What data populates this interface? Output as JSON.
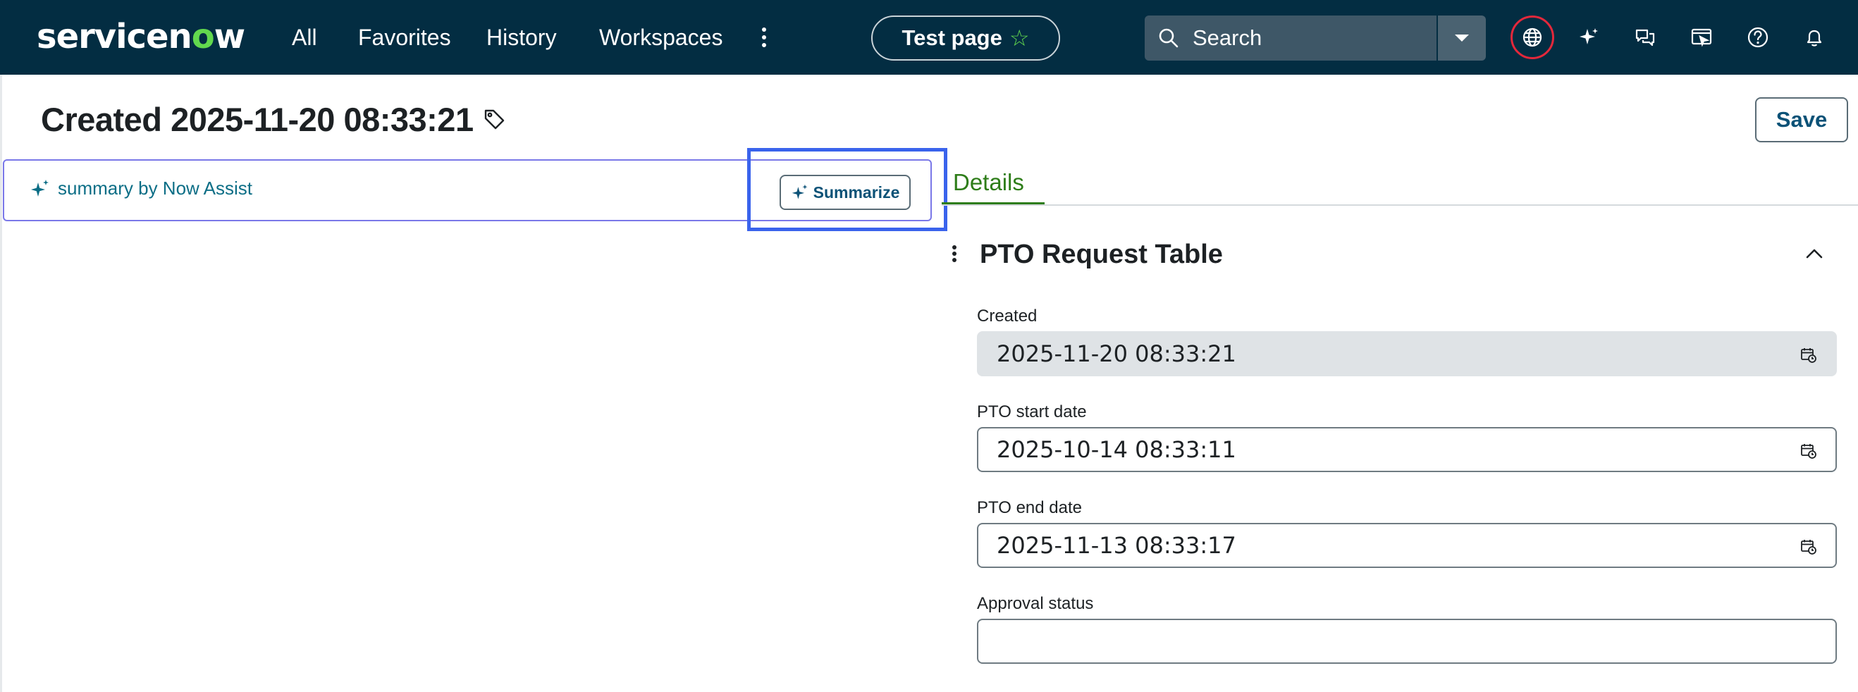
{
  "app": {
    "logo_prefix": "servicen",
    "logo_o": "o",
    "logo_suffix": "w"
  },
  "nav": {
    "items": [
      "All",
      "Favorites",
      "History",
      "Workspaces"
    ],
    "current_page": "Test page",
    "search_placeholder": "Search",
    "icons": [
      "globe-icon",
      "sparkle-icon",
      "chat-icon",
      "screen-icon",
      "help-icon",
      "bell-icon"
    ]
  },
  "header": {
    "title": "Created 2025-11-20 08:33:21",
    "save_label": "Save"
  },
  "summary": {
    "label": "summary by Now Assist",
    "button": "Summarize"
  },
  "tabs": {
    "active": "Details"
  },
  "form": {
    "section_title": "PTO Request Table",
    "fields": [
      {
        "label": "Created",
        "value": "2025-11-20 08:33:21",
        "readonly": true
      },
      {
        "label": "PTO start date",
        "value": "2025-10-14 08:33:11"
      },
      {
        "label": "PTO end date",
        "value": "2025-11-13 08:33:17"
      },
      {
        "label": "Approval status",
        "value": ""
      }
    ]
  },
  "colors": {
    "nav_bg": "#032d42",
    "brand_green": "#62d84e",
    "link_teal": "#0c6e86",
    "tab_green": "#2e7d19",
    "highlight_blue": "#3a63ec",
    "globe_ring_red": "#e3283b"
  }
}
